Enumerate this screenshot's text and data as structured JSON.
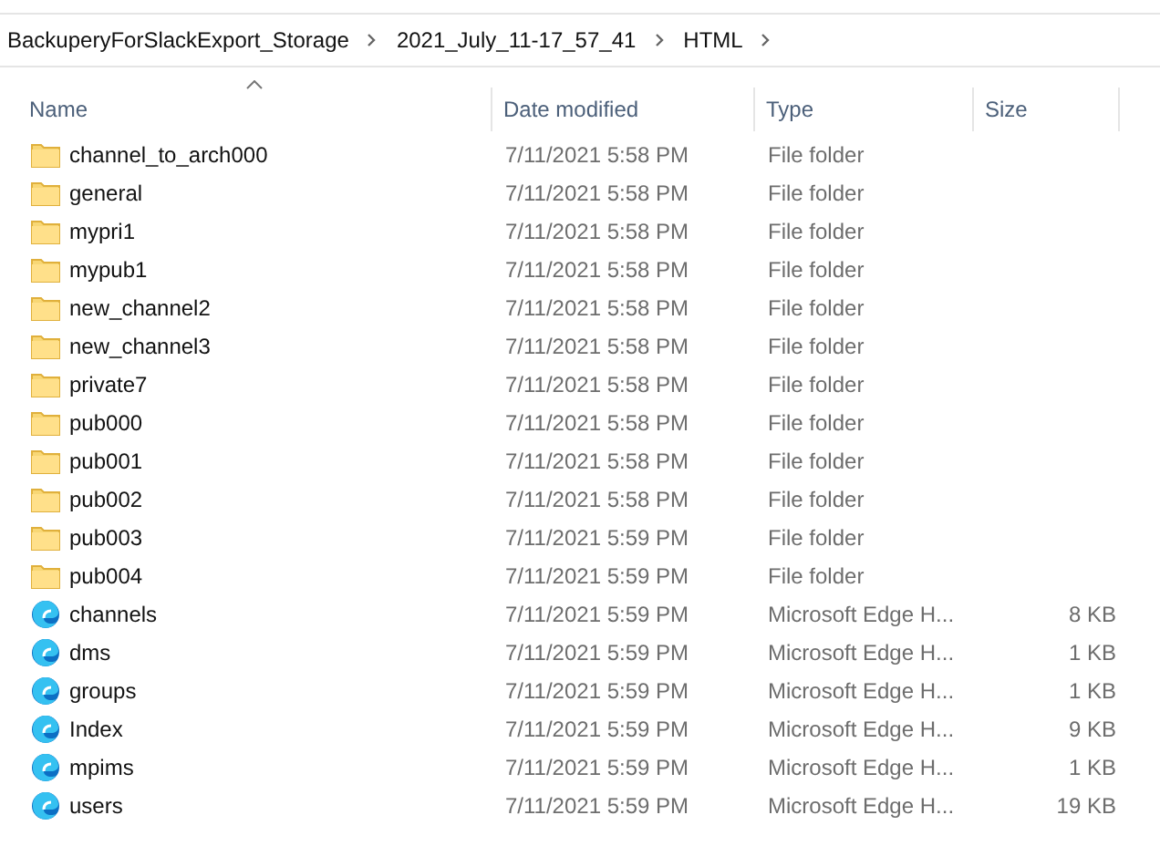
{
  "breadcrumb": [
    "BackuperyForSlackExport_Storage",
    "2021_July_11-17_57_41",
    "HTML"
  ],
  "columns": [
    {
      "label": "Name",
      "sorted": true
    },
    {
      "label": "Date modified",
      "sorted": false
    },
    {
      "label": "Type",
      "sorted": false
    },
    {
      "label": "Size",
      "sorted": false
    }
  ],
  "files": [
    {
      "kind": "folder",
      "name": "channel_to_arch000",
      "date": "7/11/2021 5:58 PM",
      "type": "File folder"
    },
    {
      "kind": "folder",
      "name": "general",
      "date": "7/11/2021 5:58 PM",
      "type": "File folder"
    },
    {
      "kind": "folder",
      "name": "mypri1",
      "date": "7/11/2021 5:58 PM",
      "type": "File folder"
    },
    {
      "kind": "folder",
      "name": "mypub1",
      "date": "7/11/2021 5:58 PM",
      "type": "File folder"
    },
    {
      "kind": "folder",
      "name": "new_channel2",
      "date": "7/11/2021 5:58 PM",
      "type": "File folder"
    },
    {
      "kind": "folder",
      "name": "new_channel3",
      "date": "7/11/2021 5:58 PM",
      "type": "File folder"
    },
    {
      "kind": "folder",
      "name": "private7",
      "date": "7/11/2021 5:58 PM",
      "type": "File folder"
    },
    {
      "kind": "folder",
      "name": "pub000",
      "date": "7/11/2021 5:58 PM",
      "type": "File folder"
    },
    {
      "kind": "folder",
      "name": "pub001",
      "date": "7/11/2021 5:58 PM",
      "type": "File folder"
    },
    {
      "kind": "folder",
      "name": "pub002",
      "date": "7/11/2021 5:58 PM",
      "type": "File folder"
    },
    {
      "kind": "folder",
      "name": "pub003",
      "date": "7/11/2021 5:59 PM",
      "type": "File folder"
    },
    {
      "kind": "folder",
      "name": "pub004",
      "date": "7/11/2021 5:59 PM",
      "type": "File folder"
    },
    {
      "kind": "html",
      "name": "channels",
      "date": "7/11/2021 5:59 PM",
      "type": "Microsoft Edge H...",
      "size": "8 KB"
    },
    {
      "kind": "html",
      "name": "dms",
      "date": "7/11/2021 5:59 PM",
      "type": "Microsoft Edge H...",
      "size": "1 KB"
    },
    {
      "kind": "html",
      "name": "groups",
      "date": "7/11/2021 5:59 PM",
      "type": "Microsoft Edge H...",
      "size": "1 KB"
    },
    {
      "kind": "html",
      "name": "Index",
      "date": "7/11/2021 5:59 PM",
      "type": "Microsoft Edge H...",
      "size": "9 KB"
    },
    {
      "kind": "html",
      "name": "mpims",
      "date": "7/11/2021 5:59 PM",
      "type": "Microsoft Edge H...",
      "size": "1 KB"
    },
    {
      "kind": "html",
      "name": "users",
      "date": "7/11/2021 5:59 PM",
      "type": "Microsoft Edge H...",
      "size": "19 KB"
    }
  ]
}
